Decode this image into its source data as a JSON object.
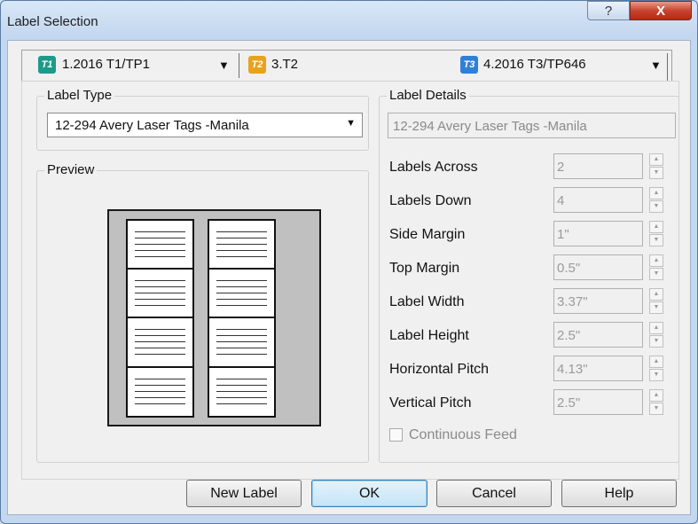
{
  "window": {
    "title": "Label Selection",
    "help_glyph": "?",
    "close_glyph": "X"
  },
  "tabs": [
    {
      "badge": "T1",
      "badge_color": "#1e9a8a",
      "label": "1.2016 T1/TP1",
      "arrow": "▼"
    },
    {
      "badge": "T2",
      "badge_color": "#e8a21c",
      "label": "3.T2"
    },
    {
      "badge": "T3",
      "badge_color": "#2f7fd8",
      "label": "4.2016 T3/TP646",
      "arrow": "▼"
    }
  ],
  "label_type": {
    "legend": "Label Type",
    "selected": "12-294 Avery Laser Tags -Manila",
    "arrow": "▼"
  },
  "preview": {
    "legend": "Preview"
  },
  "label_details": {
    "legend": "Label Details",
    "name": "12-294 Avery Laser Tags -Manila",
    "fields": [
      {
        "label": "Labels Across",
        "value": "2"
      },
      {
        "label": "Labels Down",
        "value": "4"
      },
      {
        "label": "Side Margin",
        "value": "1\""
      },
      {
        "label": "Top Margin",
        "value": "0.5\""
      },
      {
        "label": "Label Width",
        "value": "3.37\""
      },
      {
        "label": "Label Height",
        "value": "2.5\""
      },
      {
        "label": "Horizontal Pitch",
        "value": "4.13\""
      },
      {
        "label": "Vertical Pitch",
        "value": "2.5\""
      }
    ],
    "continuous_feed": {
      "label": "Continuous Feed",
      "checked": false
    }
  },
  "buttons": {
    "new_label": "New Label",
    "ok": "OK",
    "cancel": "Cancel",
    "help": "Help"
  },
  "spin_glyphs": {
    "up": "▲",
    "down": "▼"
  }
}
